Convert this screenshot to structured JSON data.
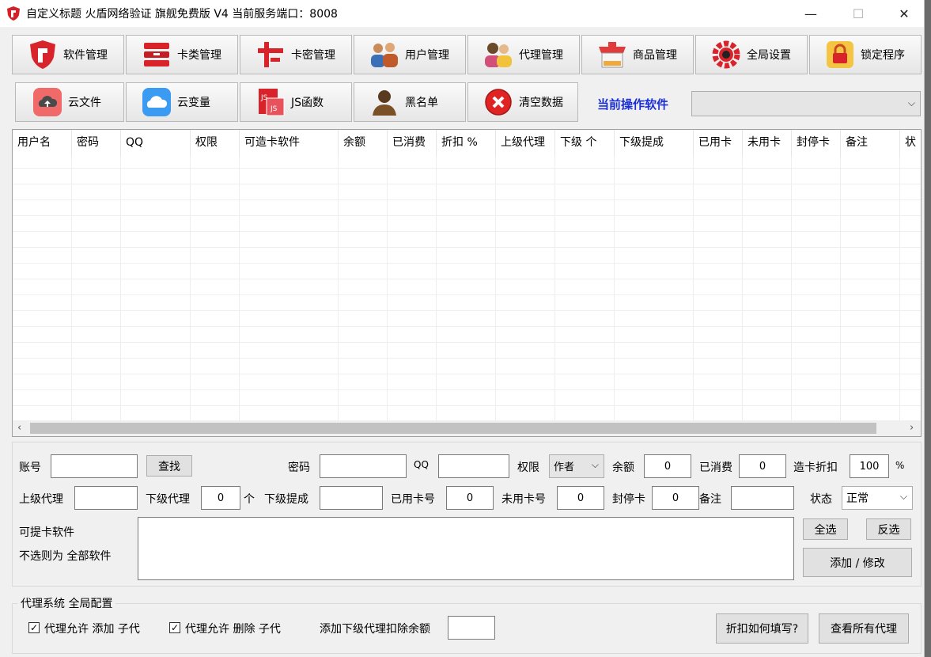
{
  "window": {
    "title": "自定义标题 火盾网络验证 旗舰免费版 V4    当前服务端口：8008",
    "minimize": "—",
    "maximize": "☐",
    "close": "✕"
  },
  "toolbar_row1": [
    {
      "label": "软件管理",
      "icon": "shield-icon"
    },
    {
      "label": "卡类管理",
      "icon": "card-stack-icon"
    },
    {
      "label": "卡密管理",
      "icon": "card-key-icon"
    },
    {
      "label": "用户管理",
      "icon": "users-icon"
    },
    {
      "label": "代理管理",
      "icon": "agents-icon"
    },
    {
      "label": "商品管理",
      "icon": "shop-icon"
    },
    {
      "label": "全局设置",
      "icon": "gear-icon"
    },
    {
      "label": "锁定程序",
      "icon": "lock-icon"
    }
  ],
  "toolbar_row2": [
    {
      "label": "云文件",
      "icon": "cloud-upload-icon"
    },
    {
      "label": "云变量",
      "icon": "cloud-icon"
    },
    {
      "label": "JS函数",
      "icon": "js-icon"
    },
    {
      "label": "黑名单",
      "icon": "blacklist-user-icon"
    },
    {
      "label": "清空数据",
      "icon": "clear-icon"
    }
  ],
  "current_software": {
    "label": "当前操作软件",
    "value": ""
  },
  "table": {
    "columns": [
      "用户名",
      "密码",
      "QQ",
      "权限",
      "可造卡软件",
      "余额",
      "已消费",
      "折扣 %",
      "上级代理",
      "下级 个",
      "下级提成",
      "已用卡",
      "未用卡",
      "封停卡",
      "备注",
      "状"
    ],
    "rows": []
  },
  "form": {
    "account_label": "账号",
    "account_value": "",
    "find_button": "查找",
    "password_label": "密码",
    "password_value": "",
    "qq_label": "QQ",
    "qq_value": "",
    "perm_label": "权限",
    "perm_value": "作者",
    "balance_label": "余额",
    "balance_value": "0",
    "consumed_label": "已消费",
    "consumed_value": "0",
    "discount_label": "造卡折扣",
    "discount_value": "100",
    "percent": "%",
    "parent_label": "上级代理",
    "parent_value": "",
    "sub_label": "下级代理",
    "sub_value": "0",
    "sub_unit": "个",
    "commission_label": "下级提成",
    "commission_value": "",
    "used_label": "已用卡号",
    "used_value": "0",
    "unused_label": "未用卡号",
    "unused_value": "0",
    "banned_label": "封停卡",
    "banned_value": "0",
    "note_label": "备注",
    "note_value": "",
    "status_label": "状态",
    "status_value": "正常",
    "soft_label": "可提卡软件",
    "soft_hint": "不选则为 全部软件",
    "select_all": "全选",
    "invert": "反选",
    "add_modify": "添加 / 修改"
  },
  "agent_config": {
    "title": "代理系统 全局配置",
    "allow_add": "代理允许 添加 子代",
    "allow_add_checked": true,
    "allow_delete": "代理允许 删除 子代",
    "allow_delete_checked": true,
    "deduct_label": "添加下级代理扣除余额",
    "deduct_value": "",
    "how_discount": "折扣如何填写?",
    "view_all": "查看所有代理"
  }
}
